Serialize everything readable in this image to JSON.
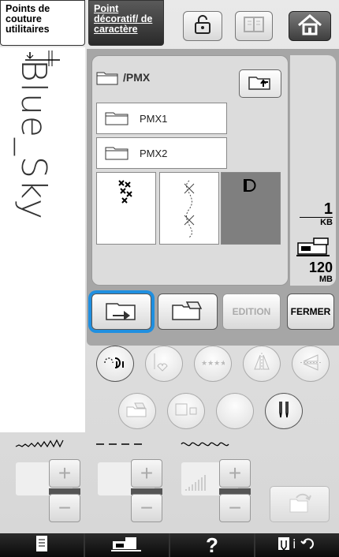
{
  "tabs": {
    "utility": "Points de couture utilitaires",
    "decorative": "Point décoratif/ de caractère"
  },
  "header_icons": [
    "lock-icon",
    "book-icon",
    "home-icon"
  ],
  "preview": {
    "text": "Blue_Sky"
  },
  "browser": {
    "path": "/PMX",
    "folders": [
      "PMX1",
      "PMX2"
    ],
    "thumbnails": [
      "pattern-thumbnail",
      "pattern-thumbnail",
      "pattern-thumbnail"
    ]
  },
  "memory": {
    "file_size": "1",
    "file_unit": "KB",
    "free_size": "120",
    "free_unit": "MB"
  },
  "actions": {
    "edit_label": "EDITION",
    "close_label": "FERMER"
  },
  "status": {
    "help": "?"
  },
  "colors": {
    "highlight": "#1f8fe0",
    "panel": "#a6a6a6"
  }
}
